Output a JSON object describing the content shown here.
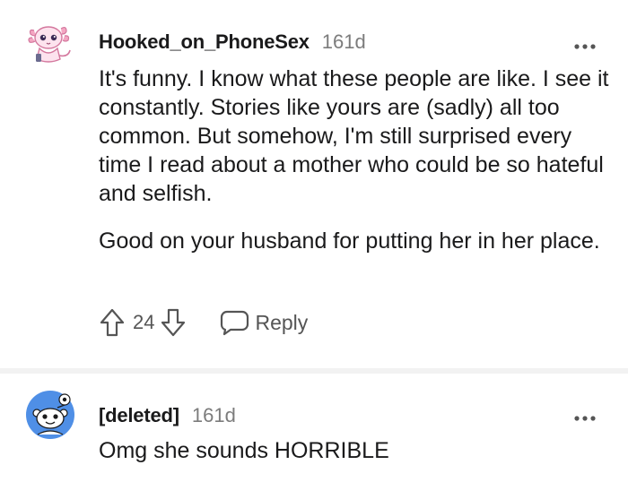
{
  "comments": [
    {
      "username": "Hooked_on_PhoneSex",
      "age": "161d",
      "avatar_icon": "axolotl-avatar-icon",
      "paragraphs": [
        "It's funny. I know what these people are like. I see it constantly. Stories like yours are (sadly) all too common. But somehow, I'm still surprised every time I read about a mother who could be so hateful and selfish.",
        "Good on your husband for putting her in her place."
      ],
      "score": "24",
      "reply_label": "Reply"
    },
    {
      "username": "[deleted]",
      "age": "161d",
      "avatar_icon": "snoo-avatar-icon",
      "paragraphs": [
        "Omg she sounds HORRIBLE"
      ]
    }
  ],
  "colors": {
    "text": "#1a1a1b",
    "muted": "#7c7c7c",
    "icon": "#555555",
    "avatar_blue": "#4f8fe6",
    "avatar_pink": "#f4a6c2",
    "divider": "#f2f2f2"
  }
}
